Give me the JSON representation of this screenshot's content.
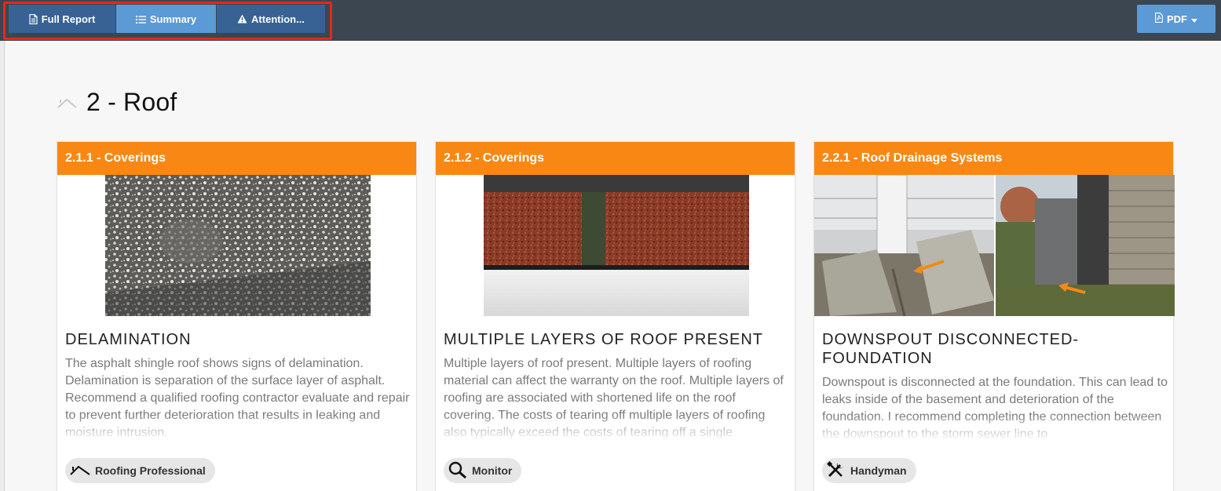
{
  "toolbar": {
    "tabs": [
      {
        "label": "Full Report",
        "icon": "document-icon"
      },
      {
        "label": "Summary",
        "icon": "list-icon"
      },
      {
        "label": "Attention...",
        "icon": "warning-icon"
      }
    ],
    "pdf_label": "PDF"
  },
  "section": {
    "title": "2 - Roof"
  },
  "cards": [
    {
      "header": "2.1.1 - Coverings",
      "title": "DELAMINATION",
      "description": "The asphalt shingle roof shows signs of delamination. Delamination is separation of the surface layer of asphalt. Recommend a qualified roofing contractor evaluate and repair to prevent further deterioration that results in leaking and moisture intrusion.",
      "badge": "Roofing Professional",
      "badge_icon": "roof-icon"
    },
    {
      "header": "2.1.2 - Coverings",
      "title": "MULTIPLE LAYERS OF ROOF PRESENT",
      "description": "Multiple layers of roof present.  Multiple layers of roofing material can affect the warranty on the roof.  Multiple layers of roofing are associated with shortened life on the roof covering.  The costs of tearing off multiple layers of roofing also typically exceed the costs of tearing off a single",
      "badge": "Monitor",
      "badge_icon": "magnifier-icon"
    },
    {
      "header": "2.2.1 - Roof Drainage Systems",
      "title": "DOWNSPOUT DISCONNECTED-FOUNDATION",
      "description": "Downspout is disconnected at the foundation. This can lead to leaks inside of the basement and deterioration of the foundation. I recommend completing the connection between the downspout to the storm sewer line to",
      "badge": "Handyman",
      "badge_icon": "tools-icon"
    }
  ],
  "colors": {
    "topbar": "#3b4650",
    "tab_dark": "#376293",
    "tab_active": "#5b9ad4",
    "card_header": "#f88813",
    "highlight_frame": "#e8261a"
  }
}
